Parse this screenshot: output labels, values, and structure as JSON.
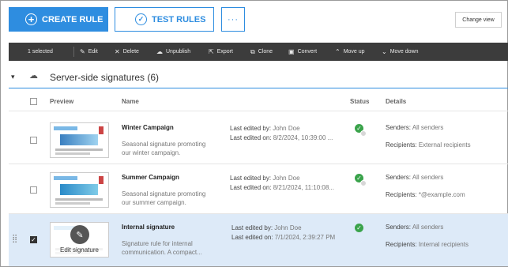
{
  "actions": {
    "create_rule": "CREATE RULE",
    "test_rules": "TEST RULES",
    "more": "···",
    "change_view": "Change view"
  },
  "toolbar": {
    "selected": "1 selected",
    "edit": "Edit",
    "delete": "Delete",
    "unpublish": "Unpublish",
    "export": "Export",
    "clone": "Clone",
    "convert": "Convert",
    "move_up": "Move up",
    "move_down": "Move down"
  },
  "group": {
    "title": "Server-side signatures (6)"
  },
  "columns": {
    "preview": "Preview",
    "name": "Name",
    "status": "Status",
    "details": "Details"
  },
  "rows": [
    {
      "name": "Winter Campaign",
      "description": "Seasonal signature promoting our winter campaign.",
      "edited_by_label": "Last edited by:",
      "edited_by": "John Doe",
      "edited_on_label": "Last edited on:",
      "edited_on": "8/2/2024, 10:39:00 ...",
      "senders_label": "Senders:",
      "senders": "All senders",
      "recipients_label": "Recipients:",
      "recipients": "External recipients",
      "selected": false
    },
    {
      "name": "Summer Campaign",
      "description": "Seasonal signature promoting our summer campaign.",
      "edited_by_label": "Last edited by:",
      "edited_by": "John Doe",
      "edited_on_label": "Last edited on:",
      "edited_on": "8/21/2024, 11:10:08...",
      "senders_label": "Senders:",
      "senders": "All senders",
      "recipients_label": "Recipients:",
      "recipients": "*@example.com",
      "selected": false
    },
    {
      "name": "Internal signature",
      "description": "Signature rule for internal communication. A compact...",
      "edited_by_label": "Last edited by:",
      "edited_by": "John Doe",
      "edited_on_label": "Last edited on:",
      "edited_on": "7/1/2024, 2:39:27 PM",
      "senders_label": "Senders:",
      "senders": "All senders",
      "recipients_label": "Recipients:",
      "recipients": "Internal recipients",
      "selected": true,
      "overlay_label": "Edit signature"
    }
  ],
  "colors": {
    "accent": "#2e8de0",
    "toolbar": "#3c3c3c",
    "status_ok": "#3aa34b",
    "selected_row": "#ddeaf8"
  }
}
